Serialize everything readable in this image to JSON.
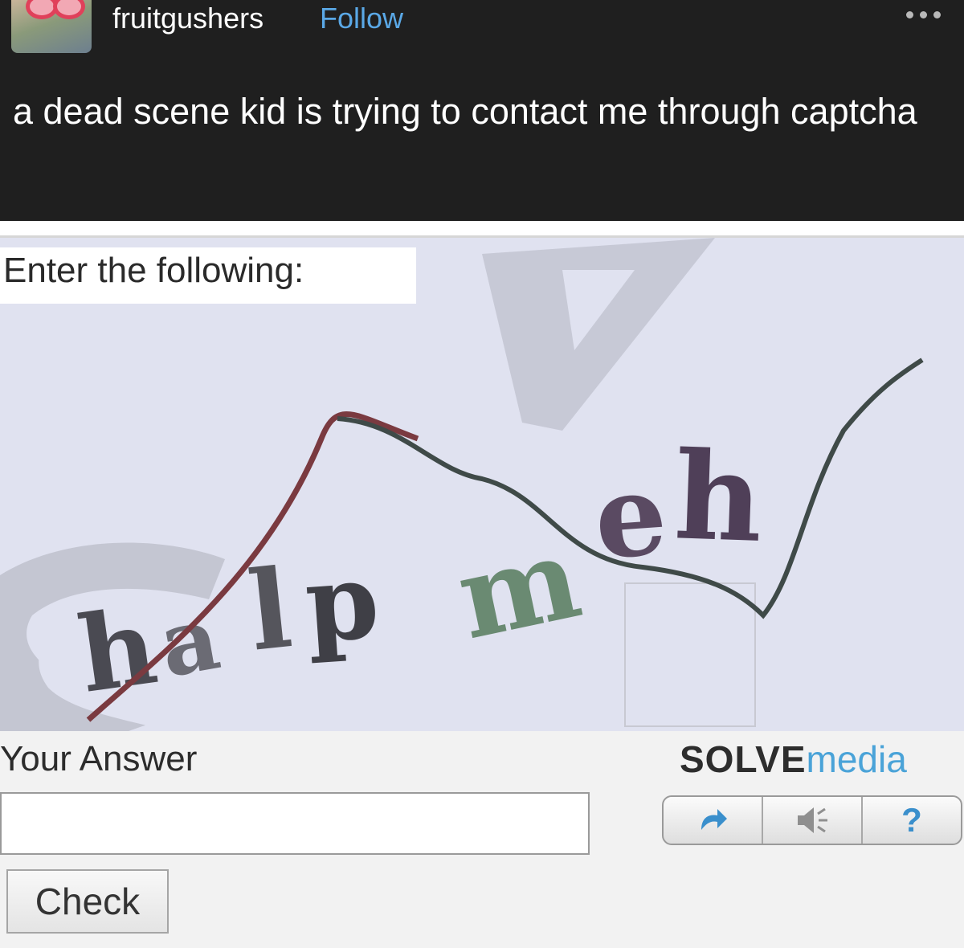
{
  "post": {
    "username": "fruitgushers",
    "follow_label": "Follow",
    "text": "a dead scene kid is trying to contact me through captcha"
  },
  "captcha": {
    "prompt": "Enter the following:",
    "challenge_text": "halp meh",
    "answer_label": "Your Answer",
    "answer_value": "",
    "brand_part1": "SOLVE",
    "brand_part2": "media",
    "controls": [
      "refresh-icon",
      "audio-icon",
      "help-icon"
    ],
    "help_label": "?",
    "check_label": "Check"
  },
  "colors": {
    "header_bg": "#1f1f1f",
    "follow": "#5aa8e6",
    "brand_blue": "#4aa3d8",
    "captcha_bg": "#e0e2f0"
  }
}
